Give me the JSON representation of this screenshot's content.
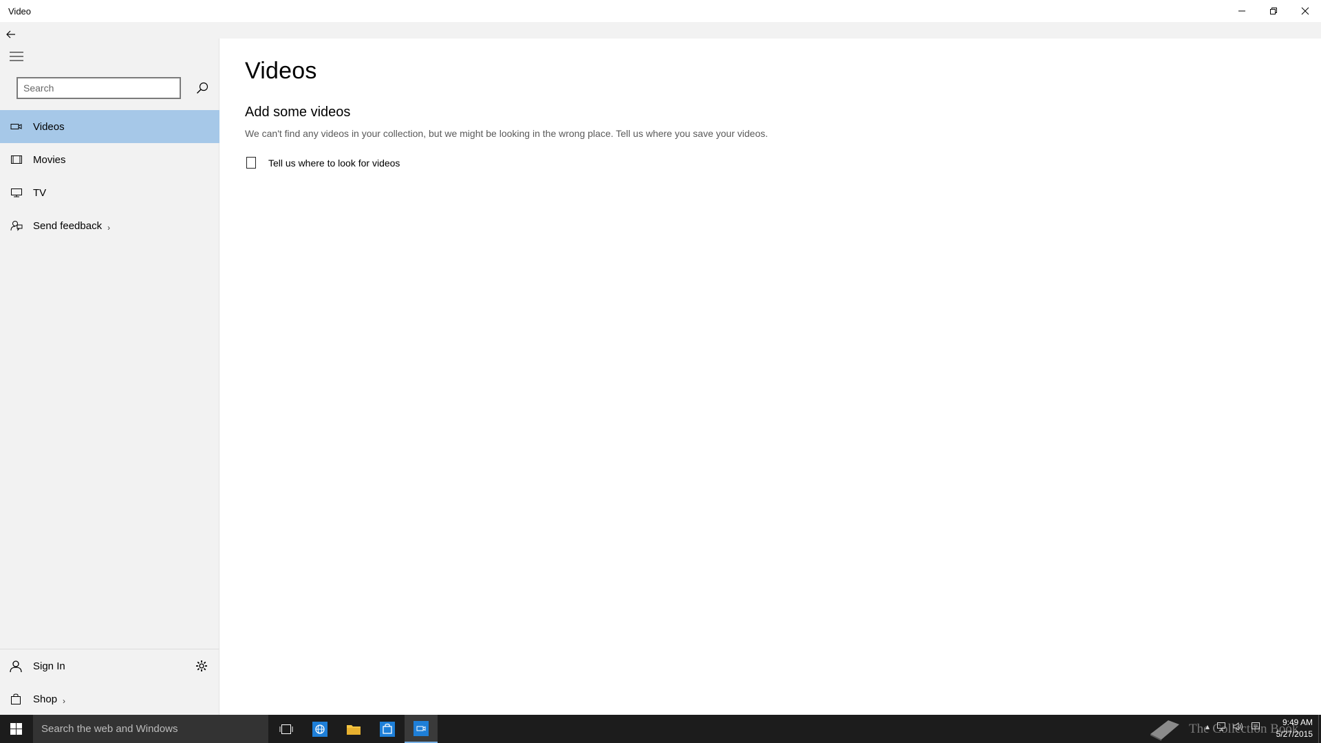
{
  "window": {
    "title": "Video"
  },
  "sidebar": {
    "search_placeholder": "Search",
    "items": [
      {
        "label": "Videos",
        "icon": "video-camera-icon",
        "active": true
      },
      {
        "label": "Movies",
        "icon": "film-icon",
        "active": false
      },
      {
        "label": "TV",
        "icon": "tv-icon",
        "active": false
      },
      {
        "label": "Send feedback",
        "icon": "feedback-icon",
        "active": false,
        "chevron": "›"
      }
    ],
    "bottom": {
      "sign_in_label": "Sign In",
      "shop_label": "Shop",
      "shop_chevron": "›"
    }
  },
  "main": {
    "page_title": "Videos",
    "section_title": "Add some videos",
    "section_desc": "We can't find any videos in your collection, but we might be looking in the wrong place. Tell us where you save your videos.",
    "link_label": "Tell us where to look for videos"
  },
  "taskbar": {
    "search_text": "Search the web and Windows",
    "watermark": "The Collection Book",
    "time": "9:49 AM",
    "date": "5/27/2015"
  },
  "colors": {
    "accent_selected": "#a6c8e8",
    "sidebar_bg": "#f2f2f2",
    "taskbar_bg": "#1c1c1c",
    "taskbar_search_bg": "#333333"
  }
}
